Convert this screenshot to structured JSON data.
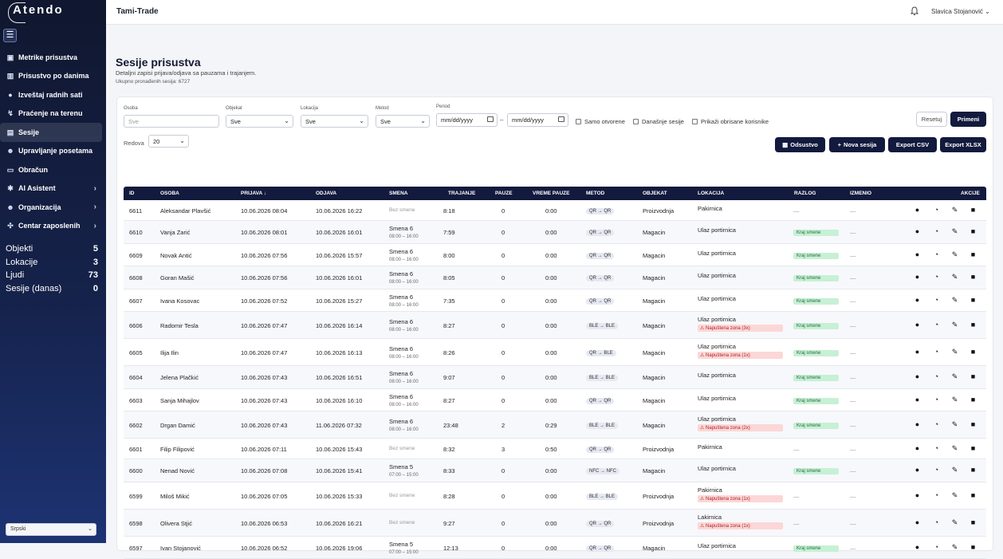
{
  "sidebar": {
    "logo": "Atendo",
    "items": [
      {
        "label": "Metrike prisustva",
        "icon": "dashboard-icon",
        "glyph": "▣"
      },
      {
        "label": "Prisustvo po danima",
        "icon": "bar-chart-icon",
        "glyph": "▥"
      },
      {
        "label": "Izveštaj radnih sati",
        "icon": "user-icon",
        "glyph": "●"
      },
      {
        "label": "Praćenje na terenu",
        "icon": "route-icon",
        "glyph": "↯"
      },
      {
        "label": "Sesije",
        "icon": "calendar-icon",
        "glyph": "▤"
      },
      {
        "label": "Upravljanje posetama",
        "icon": "visitors-icon",
        "glyph": "☻"
      },
      {
        "label": "Obračun",
        "icon": "wallet-icon",
        "glyph": "▭"
      },
      {
        "label": "AI Asistent",
        "icon": "gear-icon",
        "glyph": "✱"
      },
      {
        "label": "Organizacija",
        "icon": "users-icon",
        "glyph": "☻"
      },
      {
        "label": "Centar zaposlenih",
        "icon": "hub-icon",
        "glyph": "✣"
      }
    ],
    "stats": [
      {
        "label": "Objekti",
        "value": "5"
      },
      {
        "label": "Lokacije",
        "value": "3"
      },
      {
        "label": "Ljudi",
        "value": "73"
      },
      {
        "label": "Sesije (danas)",
        "value": "0"
      }
    ],
    "language": "Srpski"
  },
  "topbar": {
    "company": "Tami-Trade",
    "user": "Slavica Stojanović ⌄"
  },
  "page": {
    "title": "Sesije prisustva",
    "subtitle": "Detaljni zapisi prijava/odjava sa pauzama i trajanjem.",
    "count": "Ukupno pronađenih sesija: 6727"
  },
  "filters": {
    "osoba_label": "Osoba",
    "osoba_placeholder": "Sve",
    "objekat_label": "Objekat",
    "objekat_value": "Sve",
    "lokacija_label": "Lokacija",
    "lokacija_value": "Sve",
    "metod_label": "Metod",
    "metod_value": "Sve",
    "period_label": "Period",
    "date_from": "mm/dd/yyyy",
    "date_to": "mm/dd/yyyy",
    "dash": "–",
    "samo_otvorene": "Samo otvorene",
    "danasnje": "Današnje sesije",
    "obrisane": "Prikaži obrisane korisnike",
    "redova_label": "Redova",
    "redova_value": "20",
    "reset": "Resetuj",
    "apply": "Primeni",
    "odsustvo": "Odsustvo",
    "nova": "Nova sesija",
    "csv": "Export CSV",
    "xlsx": "Export XLSX"
  },
  "table": {
    "headers": [
      "ID",
      "OSOBA",
      "PRIJAVA ↓",
      "ODJAVA",
      "SMENA",
      "TRAJANJE",
      "PAUZE",
      "VREME PAUZE",
      "METOD",
      "OBJEKAT",
      "LOKACIJA",
      "RAZLOG",
      "IZMENIO",
      "AKCIJE"
    ],
    "rows": [
      {
        "id": "6611",
        "osoba": "Aleksandar Plavšić",
        "prijava": "10.06.2026 08:04",
        "odjava": "10.06.2026 16:22",
        "smena": "Bez smene",
        "smena_time": "",
        "trajanje": "8:18",
        "pauze": "0",
        "vreme_pauze": "0:00",
        "metod": "QR → QR",
        "objekat": "Proizvodnja",
        "lokacija": "Pakirnica",
        "warn": "",
        "razlog": "—",
        "izmenio": "—"
      },
      {
        "id": "6610",
        "osoba": "Vanja Zarić",
        "prijava": "10.06.2026 08:01",
        "odjava": "10.06.2026 16:01",
        "smena": "Smena 6",
        "smena_time": "08:00 – 16:00",
        "trajanje": "7:59",
        "pauze": "0",
        "vreme_pauze": "0:00",
        "metod": "QR → QR",
        "objekat": "Magacin",
        "lokacija": "Ulaz portirnica",
        "warn": "",
        "razlog": "Kraj smene",
        "izmenio": "—"
      },
      {
        "id": "6609",
        "osoba": "Novak Antić",
        "prijava": "10.06.2026 07:56",
        "odjava": "10.06.2026 15:57",
        "smena": "Smena 6",
        "smena_time": "08:00 – 16:00",
        "trajanje": "8:00",
        "pauze": "0",
        "vreme_pauze": "0:00",
        "metod": "QR → QR",
        "objekat": "Magacin",
        "lokacija": "Ulaz portirnica",
        "warn": "",
        "razlog": "Kraj smene",
        "izmenio": "—"
      },
      {
        "id": "6608",
        "osoba": "Goran Mašić",
        "prijava": "10.06.2026 07:56",
        "odjava": "10.06.2026 16:01",
        "smena": "Smena 6",
        "smena_time": "08:00 – 16:00",
        "trajanje": "8:05",
        "pauze": "0",
        "vreme_pauze": "0:00",
        "metod": "QR → QR",
        "objekat": "Magacin",
        "lokacija": "Ulaz portirnica",
        "warn": "",
        "razlog": "Kraj smene",
        "izmenio": "—"
      },
      {
        "id": "6607",
        "osoba": "Ivana Kosovac",
        "prijava": "10.06.2026 07:52",
        "odjava": "10.06.2026 15:27",
        "smena": "Smena 6",
        "smena_time": "08:00 – 16:00",
        "trajanje": "7:35",
        "pauze": "0",
        "vreme_pauze": "0:00",
        "metod": "QR → QR",
        "objekat": "Magacin",
        "lokacija": "Ulaz portirnica",
        "warn": "",
        "razlog": "Kraj smene",
        "izmenio": "—"
      },
      {
        "id": "6606",
        "osoba": "Radomir Tesla",
        "prijava": "10.06.2026 07:47",
        "odjava": "10.06.2026 16:14",
        "smena": "Smena 6",
        "smena_time": "08:00 – 16:00",
        "trajanje": "8:27",
        "pauze": "0",
        "vreme_pauze": "0:00",
        "metod": "BLE → BLE",
        "objekat": "Magacin",
        "lokacija": "Ulaz portirnica",
        "warn": "Napuštena zona (3x)",
        "razlog": "Kraj smene",
        "izmenio": "—"
      },
      {
        "id": "6605",
        "osoba": "Ilija Ilin",
        "prijava": "10.06.2026 07:47",
        "odjava": "10.06.2026 16:13",
        "smena": "Smena 6",
        "smena_time": "08:00 – 16:00",
        "trajanje": "8:26",
        "pauze": "0",
        "vreme_pauze": "0:00",
        "metod": "QR → BLE",
        "objekat": "Magacin",
        "lokacija": "Ulaz portirnica",
        "warn": "Napuštena zona (1x)",
        "razlog": "Kraj smene",
        "izmenio": "—"
      },
      {
        "id": "6604",
        "osoba": "Jelena Plačkić",
        "prijava": "10.06.2026 07:43",
        "odjava": "10.06.2026 16:51",
        "smena": "Smena 6",
        "smena_time": "08:00 – 16:00",
        "trajanje": "9:07",
        "pauze": "0",
        "vreme_pauze": "0:00",
        "metod": "BLE → BLE",
        "objekat": "Magacin",
        "lokacija": "Ulaz portirnica",
        "warn": "",
        "razlog": "Kraj smene",
        "izmenio": "—"
      },
      {
        "id": "6603",
        "osoba": "Sanja Mihajlov",
        "prijava": "10.06.2026 07:43",
        "odjava": "10.06.2026 16:10",
        "smena": "Smena 6",
        "smena_time": "08:00 – 16:00",
        "trajanje": "8:27",
        "pauze": "0",
        "vreme_pauze": "0:00",
        "metod": "QR → QR",
        "objekat": "Magacin",
        "lokacija": "Ulaz portirnica",
        "warn": "",
        "razlog": "Kraj smene",
        "izmenio": "—"
      },
      {
        "id": "6602",
        "osoba": "Drgan Damić",
        "prijava": "10.06.2026 07:43",
        "odjava": "11.06.2026 07:32",
        "smena": "Smena 6",
        "smena_time": "08:00 – 16:00",
        "trajanje": "23:48",
        "pauze": "2",
        "vreme_pauze": "0:29",
        "metod": "BLE → BLE",
        "objekat": "Magacin",
        "lokacija": "Ulaz portirnica",
        "warn": "Napuštena zona (2x)",
        "razlog": "Kraj smene",
        "izmenio": "—"
      },
      {
        "id": "6601",
        "osoba": "Filip Filipović",
        "prijava": "10.06.2026 07:11",
        "odjava": "10.06.2026 15:43",
        "smena": "Bez smene",
        "smena_time": "",
        "trajanje": "8:32",
        "pauze": "3",
        "vreme_pauze": "0:50",
        "metod": "QR → QR",
        "objekat": "Proizvodnja",
        "lokacija": "Pakirnica",
        "warn": "",
        "razlog": "—",
        "izmenio": "—"
      },
      {
        "id": "6600",
        "osoba": "Nenad Nović",
        "prijava": "10.06.2026 07:08",
        "odjava": "10.06.2026 15:41",
        "smena": "Smena 5",
        "smena_time": "07:00 – 15:00",
        "trajanje": "8:33",
        "pauze": "0",
        "vreme_pauze": "0:00",
        "metod": "NFC → NFC",
        "objekat": "Magacin",
        "lokacija": "Ulaz portirnica",
        "warn": "",
        "razlog": "Kraj smene",
        "izmenio": "—"
      },
      {
        "id": "6599",
        "osoba": "Miloš Mikić",
        "prijava": "10.06.2026 07:05",
        "odjava": "10.06.2026 15:33",
        "smena": "Bez smene",
        "smena_time": "",
        "trajanje": "8:28",
        "pauze": "0",
        "vreme_pauze": "0:00",
        "metod": "BLE → BLE",
        "objekat": "Proizvodnja",
        "lokacija": "Pakirnica",
        "warn": "Napuštena zona (1x)",
        "razlog": "—",
        "izmenio": "—"
      },
      {
        "id": "6598",
        "osoba": "Olivera Stjić",
        "prijava": "10.06.2026 06:53",
        "odjava": "10.06.2026 16:21",
        "smena": "Bez smene",
        "smena_time": "",
        "trajanje": "9:27",
        "pauze": "0",
        "vreme_pauze": "0:00",
        "metod": "QR → QR",
        "objekat": "Proizvodnja",
        "lokacija": "Lakirnica",
        "warn": "Napuštena zona (1x)",
        "razlog": "—",
        "izmenio": "—"
      },
      {
        "id": "6597",
        "osoba": "Ivan Stojanović",
        "prijava": "10.06.2026 06:52",
        "odjava": "10.06.2026 19:06",
        "smena": "Smena 5",
        "smena_time": "07:00 – 15:00",
        "trajanje": "12:13",
        "pauze": "0",
        "vreme_pauze": "0:00",
        "metod": "QR → QR",
        "objekat": "Magacin",
        "lokacija": "Ulaz portirnica",
        "warn": "",
        "razlog": "Kraj smene",
        "izmenio": "—"
      }
    ]
  }
}
